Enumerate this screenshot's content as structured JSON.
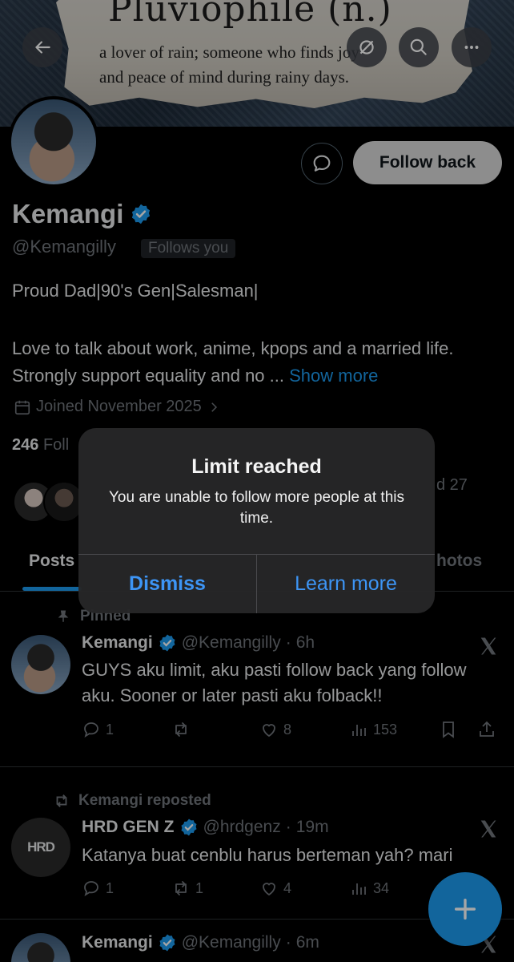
{
  "banner": {
    "title": "Pluviophile (n.)",
    "line1": "a lover of rain; someone who finds joy",
    "line2": "and peace of mind during rainy days."
  },
  "icons": {
    "back": "back-arrow-icon",
    "grok": "grok-icon",
    "search": "search-icon",
    "more": "more-icon",
    "message": "message-icon"
  },
  "profile": {
    "follow_back_label": "Follow back",
    "name": "Kemangi",
    "handle": "@Kemangilly",
    "follows_you": "Follows you",
    "bio_line1": "Proud Dad|90's Gen|Salesman|",
    "bio_line2": "Love to talk about work, anime, kpops and a married life. Strongly support equality and no ...",
    "show_more": "Show more",
    "joined": "Joined November 2025",
    "following_count": "246",
    "following_label": "Foll",
    "followed_by_tail": "d 27"
  },
  "tabs": {
    "posts": "Posts",
    "photos": "hotos"
  },
  "posts": [
    {
      "label": "Pinned",
      "name": "Kemangi",
      "handle": "@Kemangilly",
      "time": "6h",
      "text": "GUYS aku limit, aku pasti follow back yang follow aku. Sooner or later pasti aku folback!!",
      "replies": "1",
      "reposts": "",
      "likes": "8",
      "views": "153"
    },
    {
      "label": "Kemangi reposted",
      "name": "HRD GEN Z",
      "handle": "@hrdgenz",
      "time": "19m",
      "text": "Katanya buat cenblu harus berteman yah? mari",
      "replies": "1",
      "reposts": "1",
      "likes": "4",
      "views": "34",
      "avatar_text": "HRD"
    },
    {
      "name": "Kemangi",
      "handle": "@Kemangilly",
      "time": "6m"
    }
  ],
  "dialog": {
    "title": "Limit reached",
    "message": "You are unable to follow more people at this time.",
    "dismiss": "Dismiss",
    "learn_more": "Learn more"
  },
  "colors": {
    "accent": "#1d9bf0",
    "dialog_button": "#3d95f5"
  }
}
